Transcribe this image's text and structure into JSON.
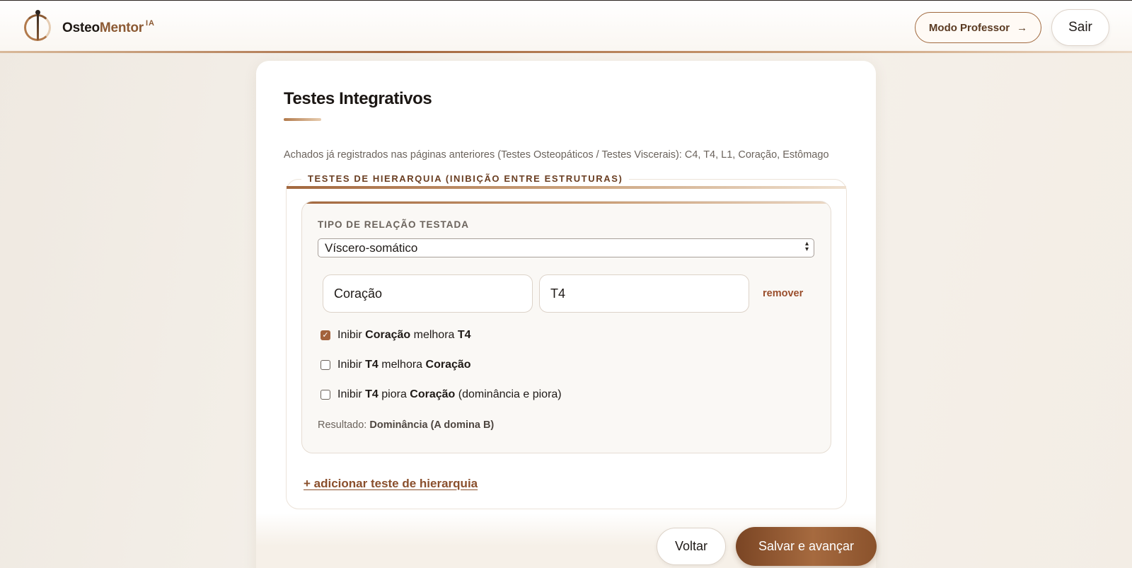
{
  "header": {
    "brand_main": "Osteo",
    "brand_accent": "Mentor",
    "brand_sup": "IA",
    "modo_professor": "Modo Professor",
    "modo_professor_arrow": "→",
    "sair": "Sair"
  },
  "page": {
    "title": "Testes Integrativos",
    "found_text": "Achados já registrados nas páginas anteriores (Testes Osteopáticos / Testes Viscerais): C4, T4, L1, Coração, Estômago"
  },
  "hierarchy": {
    "legend": "TESTES DE HIERARQUIA (INIBIÇÃO ENTRE ESTRUTURAS)",
    "relation_label": "TIPO DE RELAÇÃO TESTADA",
    "relation_value": "Víscero-somático",
    "structure_a": "Coração",
    "structure_b": "T4",
    "remove_label": "remover",
    "options": [
      {
        "checked": true,
        "prefix": "Inibir",
        "first": "Coração",
        "verb": "melhora",
        "second": "T4",
        "suffix": ""
      },
      {
        "checked": false,
        "prefix": "Inibir",
        "first": "T4",
        "verb": "melhora",
        "second": "Coração",
        "suffix": ""
      },
      {
        "checked": false,
        "prefix": "Inibir",
        "first": "T4",
        "verb": "piora",
        "second": "Coração",
        "suffix": "(dominância e piora)"
      }
    ],
    "result_label": "Resultado:",
    "result_value": "Dominância (A domina B)",
    "add_link": "+ adicionar teste de hierarquia"
  },
  "footer": {
    "back": "Voltar",
    "save": "Salvar e avançar"
  },
  "colors": {
    "accent": "#8c5a34",
    "primary_button": "#a66a3f",
    "link": "#8a4f2c"
  }
}
